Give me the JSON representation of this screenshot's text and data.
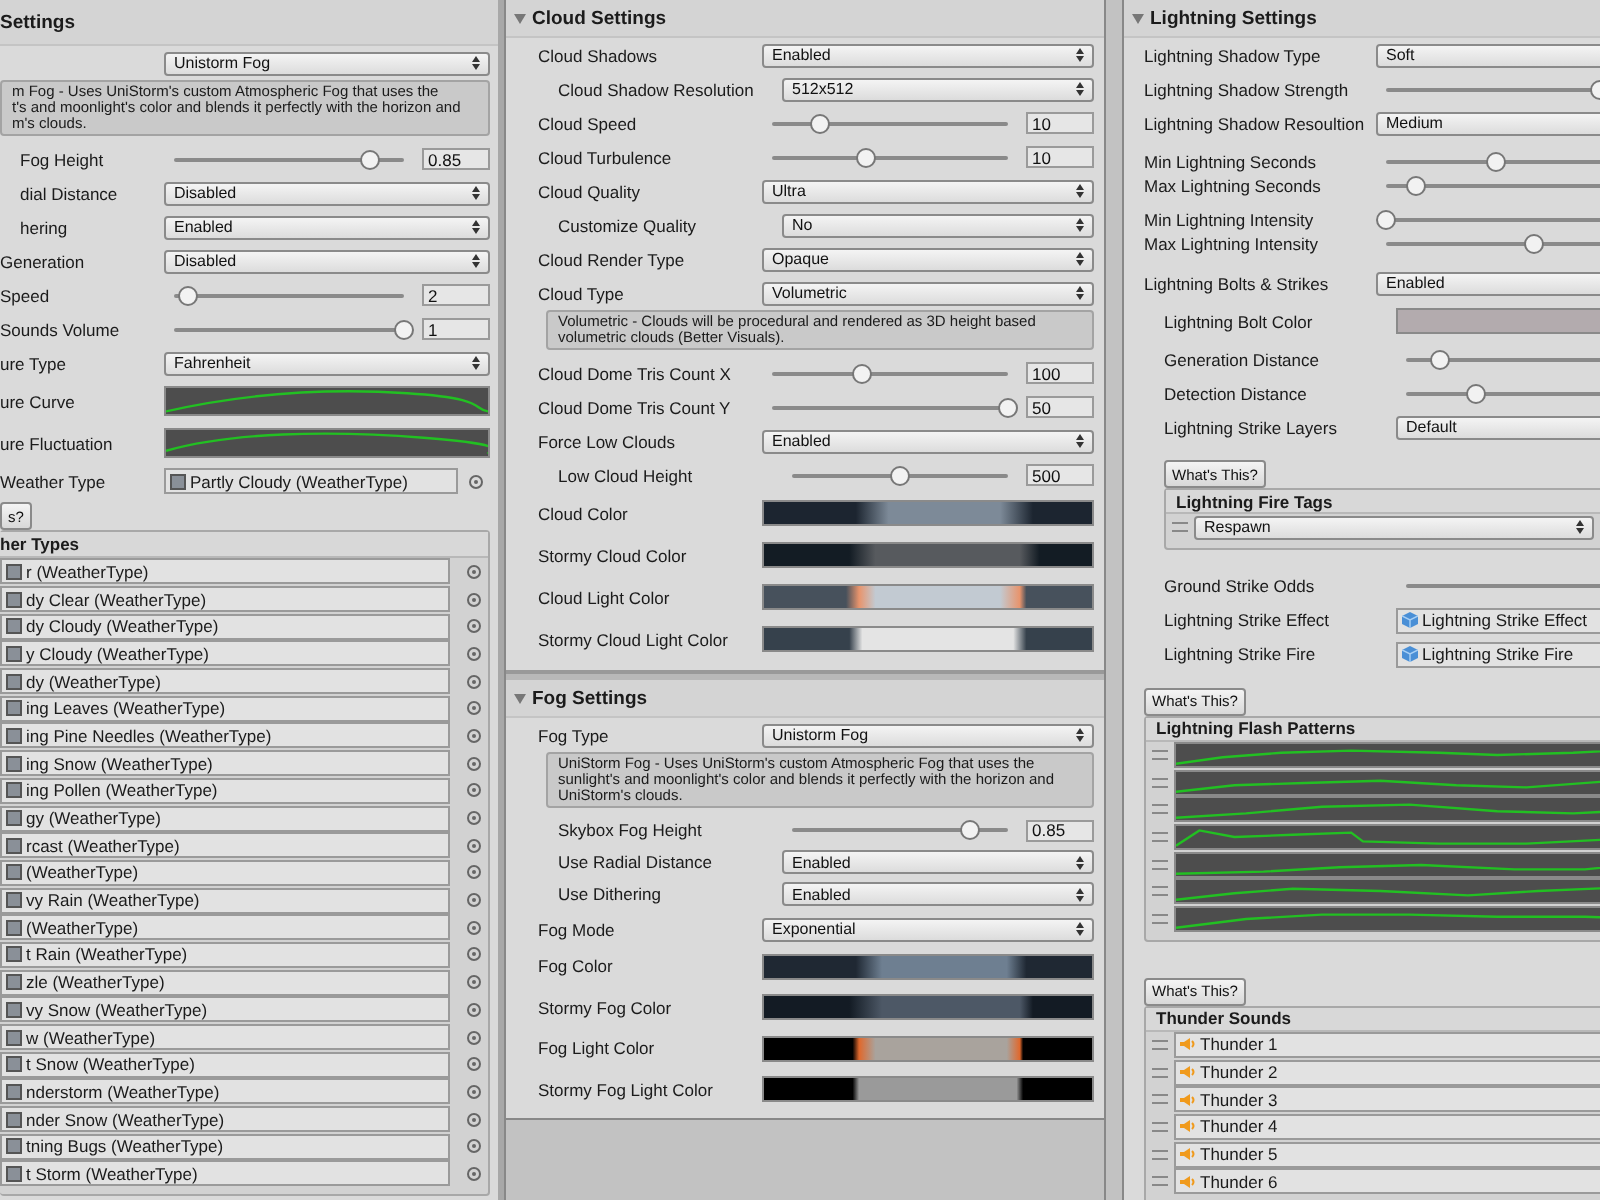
{
  "panels": [
    {
      "title": "Settings",
      "groups": [
        [
          {
            "kind": "dropdown",
            "value": "Unistorm Fog",
            "children": [
              {
                "kind": "help",
                "text": "m Fog - Uses UniStorm's custom Atmospheric Fog that uses the\nt's and moonlight's color and blends it perfectly with the horizon and\nm's clouds."
              },
              {
                "kind": "slider",
                "label": "Fog Height",
                "level": 0.85,
                "value": "0.85"
              },
              {
                "kind": "dropdown",
                "label": "dial Distance",
                "value": "Disabled"
              },
              {
                "kind": "dropdown",
                "label": "hering",
                "value": "Enabled"
              }
            ]
          },
          {
            "kind": "dropdown",
            "label": "Generation",
            "value": "Disabled"
          },
          {
            "kind": "slider",
            "label": "Speed",
            "level": 0.06,
            "value": "2"
          },
          {
            "kind": "slider",
            "label": "Sounds Volume",
            "level": 1,
            "value": "1"
          },
          {
            "kind": "dropdown",
            "label": "ure Type",
            "value": "Fahrenheit"
          },
          {
            "kind": "curve",
            "label": "ure Curve"
          },
          {
            "kind": "curve",
            "label": "ure Fluctuation"
          },
          {
            "kind": "object",
            "label": "Weather Type",
            "value": "Partly Cloudy (WeatherType)"
          },
          {
            "kind": "button",
            "label": "s?"
          },
          {
            "kind": "list",
            "title": "her Types",
            "items": [
              {
                "kind": "object",
                "value": "r (WeatherType)"
              },
              {
                "kind": "object",
                "value": "dy Clear (WeatherType)"
              },
              {
                "kind": "object",
                "value": "dy Cloudy (WeatherType)"
              },
              {
                "kind": "object",
                "value": "y Cloudy (WeatherType)"
              },
              {
                "kind": "object",
                "value": "dy (WeatherType)"
              },
              {
                "kind": "object",
                "value": "ing Leaves (WeatherType)"
              },
              {
                "kind": "object",
                "value": "ing Pine Needles (WeatherType)"
              },
              {
                "kind": "object",
                "value": "ing Snow (WeatherType)"
              },
              {
                "kind": "object",
                "value": "ing Pollen (WeatherType)"
              },
              {
                "kind": "object",
                "value": "gy (WeatherType)"
              },
              {
                "kind": "object",
                "value": "rcast (WeatherType)"
              },
              {
                "kind": "object",
                "value": "(WeatherType)"
              },
              {
                "kind": "object",
                "value": "vy Rain (WeatherType)"
              },
              {
                "kind": "object",
                "value": "(WeatherType)"
              },
              {
                "kind": "object",
                "value": "t Rain (WeatherType)"
              },
              {
                "kind": "object",
                "value": "zle (WeatherType)"
              },
              {
                "kind": "object",
                "value": "vy Snow (WeatherType)"
              },
              {
                "kind": "object",
                "value": "w (WeatherType)"
              },
              {
                "kind": "object",
                "value": "t Snow (WeatherType)"
              },
              {
                "kind": "object",
                "value": "nderstorm (WeatherType)"
              },
              {
                "kind": "object",
                "value": "nder Snow (WeatherType)"
              },
              {
                "kind": "object",
                "value": "tning Bugs (WeatherType)"
              },
              {
                "kind": "object",
                "value": "t Storm (WeatherType)"
              }
            ]
          }
        ]
      ]
    },
    {
      "title": "Cloud Settings",
      "expanded": true,
      "groups": [
        [
          {
            "kind": "dropdown",
            "label": "Cloud Shadows",
            "value": "Enabled",
            "children": [
              {
                "kind": "dropdown",
                "label": "Cloud Shadow Resolution",
                "value": "512x512"
              }
            ]
          },
          {
            "kind": "slider",
            "label": "Cloud Speed",
            "level": 0.2,
            "value": "10"
          },
          {
            "kind": "slider",
            "label": "Cloud Turbulence",
            "level": 0.4,
            "value": "10"
          },
          {
            "kind": "dropdown",
            "label": "Cloud Quality",
            "value": "Ultra",
            "children": [
              {
                "kind": "dropdown",
                "label": "Customize Quality",
                "value": "No"
              }
            ]
          },
          {
            "kind": "dropdown",
            "label": "Cloud Render Type",
            "value": "Opaque"
          },
          {
            "kind": "dropdown",
            "label": "Cloud Type",
            "value": "Volumetric",
            "children": [
              {
                "kind": "help",
                "text": "Volumetric - Clouds will be procedural and rendered as 3D height based\nvolumetric clouds (Better Visuals)."
              }
            ]
          },
          {
            "kind": "slider",
            "label": "Cloud Dome Tris Count X",
            "level": 0.38,
            "value": "100"
          },
          {
            "kind": "slider",
            "label": "Cloud Dome Tris Count Y",
            "level": 1,
            "value": "50"
          },
          {
            "kind": "dropdown",
            "label": "Force Low Clouds",
            "value": "Enabled",
            "children": [
              {
                "kind": "slider",
                "label": "Low Cloud Height",
                "level": 0.5,
                "value": "500"
              }
            ]
          },
          {
            "kind": "gradient",
            "label": "Cloud Color"
          },
          {
            "kind": "gradient",
            "label": "Stormy Cloud Color"
          },
          {
            "kind": "gradient",
            "label": "Cloud Light Color"
          },
          {
            "kind": "gradient",
            "label": "Stormy Cloud Light Color"
          }
        ]
      ]
    },
    {
      "title": "Fog Settings",
      "expanded": true,
      "groups": [
        [
          {
            "kind": "dropdown",
            "label": "Fog Type",
            "value": "Unistorm Fog",
            "children": [
              {
                "kind": "help",
                "text": "UniStorm Fog - Uses UniStorm's custom Atmospheric Fog that uses the\nsunlight's and moonlight's color and blends it perfectly with the horizon and\nUniStorm's clouds."
              },
              {
                "kind": "slider",
                "label": "Skybox Fog Height",
                "level": 0.82,
                "value": "0.85"
              },
              {
                "kind": "dropdown",
                "label": "Use Radial Distance",
                "value": "Enabled"
              },
              {
                "kind": "dropdown",
                "label": "Use Dithering",
                "value": "Enabled"
              }
            ]
          }
        ],
        [
          {
            "kind": "dropdown",
            "label": "Fog Mode",
            "value": "Exponential"
          },
          {
            "kind": "gradient",
            "label": "Fog Color"
          },
          {
            "kind": "gradient",
            "label": "Stormy Fog Color"
          },
          {
            "kind": "gradient",
            "label": "Fog Light Color"
          },
          {
            "kind": "gradient",
            "label": "Stormy Fog Light Color"
          }
        ]
      ]
    },
    {
      "title": "Lightning Settings",
      "expanded": true,
      "groups": [
        [
          {
            "kind": "dropdown",
            "label": "Lightning Shadow Type",
            "value": "Soft"
          },
          {
            "kind": "slider",
            "label": "Lightning Shadow Strength",
            "level": 0.58
          },
          {
            "kind": "dropdown",
            "label": "Lightning Shadow Resoultion",
            "value": "Medium"
          }
        ],
        [
          {
            "kind": "slider",
            "label": "Min Lightning Seconds",
            "level": 0.3
          },
          {
            "kind": "slider",
            "label": "Max Lightning Seconds",
            "level": 0.08
          }
        ],
        [
          {
            "kind": "slider",
            "label": "Min Lightning Intensity",
            "level": 0
          },
          {
            "kind": "slider",
            "label": "Max Lightning Intensity",
            "level": 0.4
          }
        ],
        [
          {
            "kind": "dropdown",
            "label": "Lightning Bolts & Strikes",
            "value": "Enabled",
            "children": [
              {
                "kind": "swatch",
                "label": "Lightning Bolt Color",
                "color": "#b3abae"
              },
              {
                "kind": "slider",
                "label": "Generation Distance",
                "level": 0.1
              },
              {
                "kind": "slider",
                "label": "Detection Distance",
                "level": 0.2
              },
              {
                "kind": "dropdown",
                "label": "Lightning Strike Layers",
                "value": "Default"
              },
              {
                "kind": "button",
                "label": "What's This?"
              },
              {
                "kind": "list",
                "title": "Lightning Fire Tags",
                "items": [
                  {
                    "kind": "tag",
                    "value": "Respawn"
                  }
                ]
              },
              {
                "kind": "slider",
                "label": "Ground Strike Odds"
              },
              {
                "kind": "prefab",
                "label": "Lightning Strike Effect",
                "value": "Lightning Strike Effect"
              },
              {
                "kind": "prefab",
                "label": "Lightning Strike Fire",
                "value": "Lightning Strike Fire"
              }
            ]
          },
          {
            "kind": "button",
            "label": "What's This?"
          },
          {
            "kind": "list",
            "title": "Lightning Flash Patterns",
            "items": [
              {
                "kind": "curve"
              },
              {
                "kind": "curve"
              },
              {
                "kind": "curve"
              },
              {
                "kind": "curve"
              },
              {
                "kind": "curve"
              },
              {
                "kind": "curve"
              },
              {
                "kind": "curve"
              }
            ]
          },
          {
            "kind": "button",
            "label": "What's This?"
          },
          {
            "kind": "list",
            "title": "Thunder Sounds",
            "items": [
              {
                "kind": "audio",
                "value": "Thunder 1"
              },
              {
                "kind": "audio",
                "value": "Thunder 2"
              },
              {
                "kind": "audio",
                "value": "Thunder 3"
              },
              {
                "kind": "audio",
                "value": "Thunder 4"
              },
              {
                "kind": "audio",
                "value": "Thunder 5"
              },
              {
                "kind": "audio",
                "value": "Thunder 6"
              }
            ]
          }
        ]
      ]
    }
  ]
}
